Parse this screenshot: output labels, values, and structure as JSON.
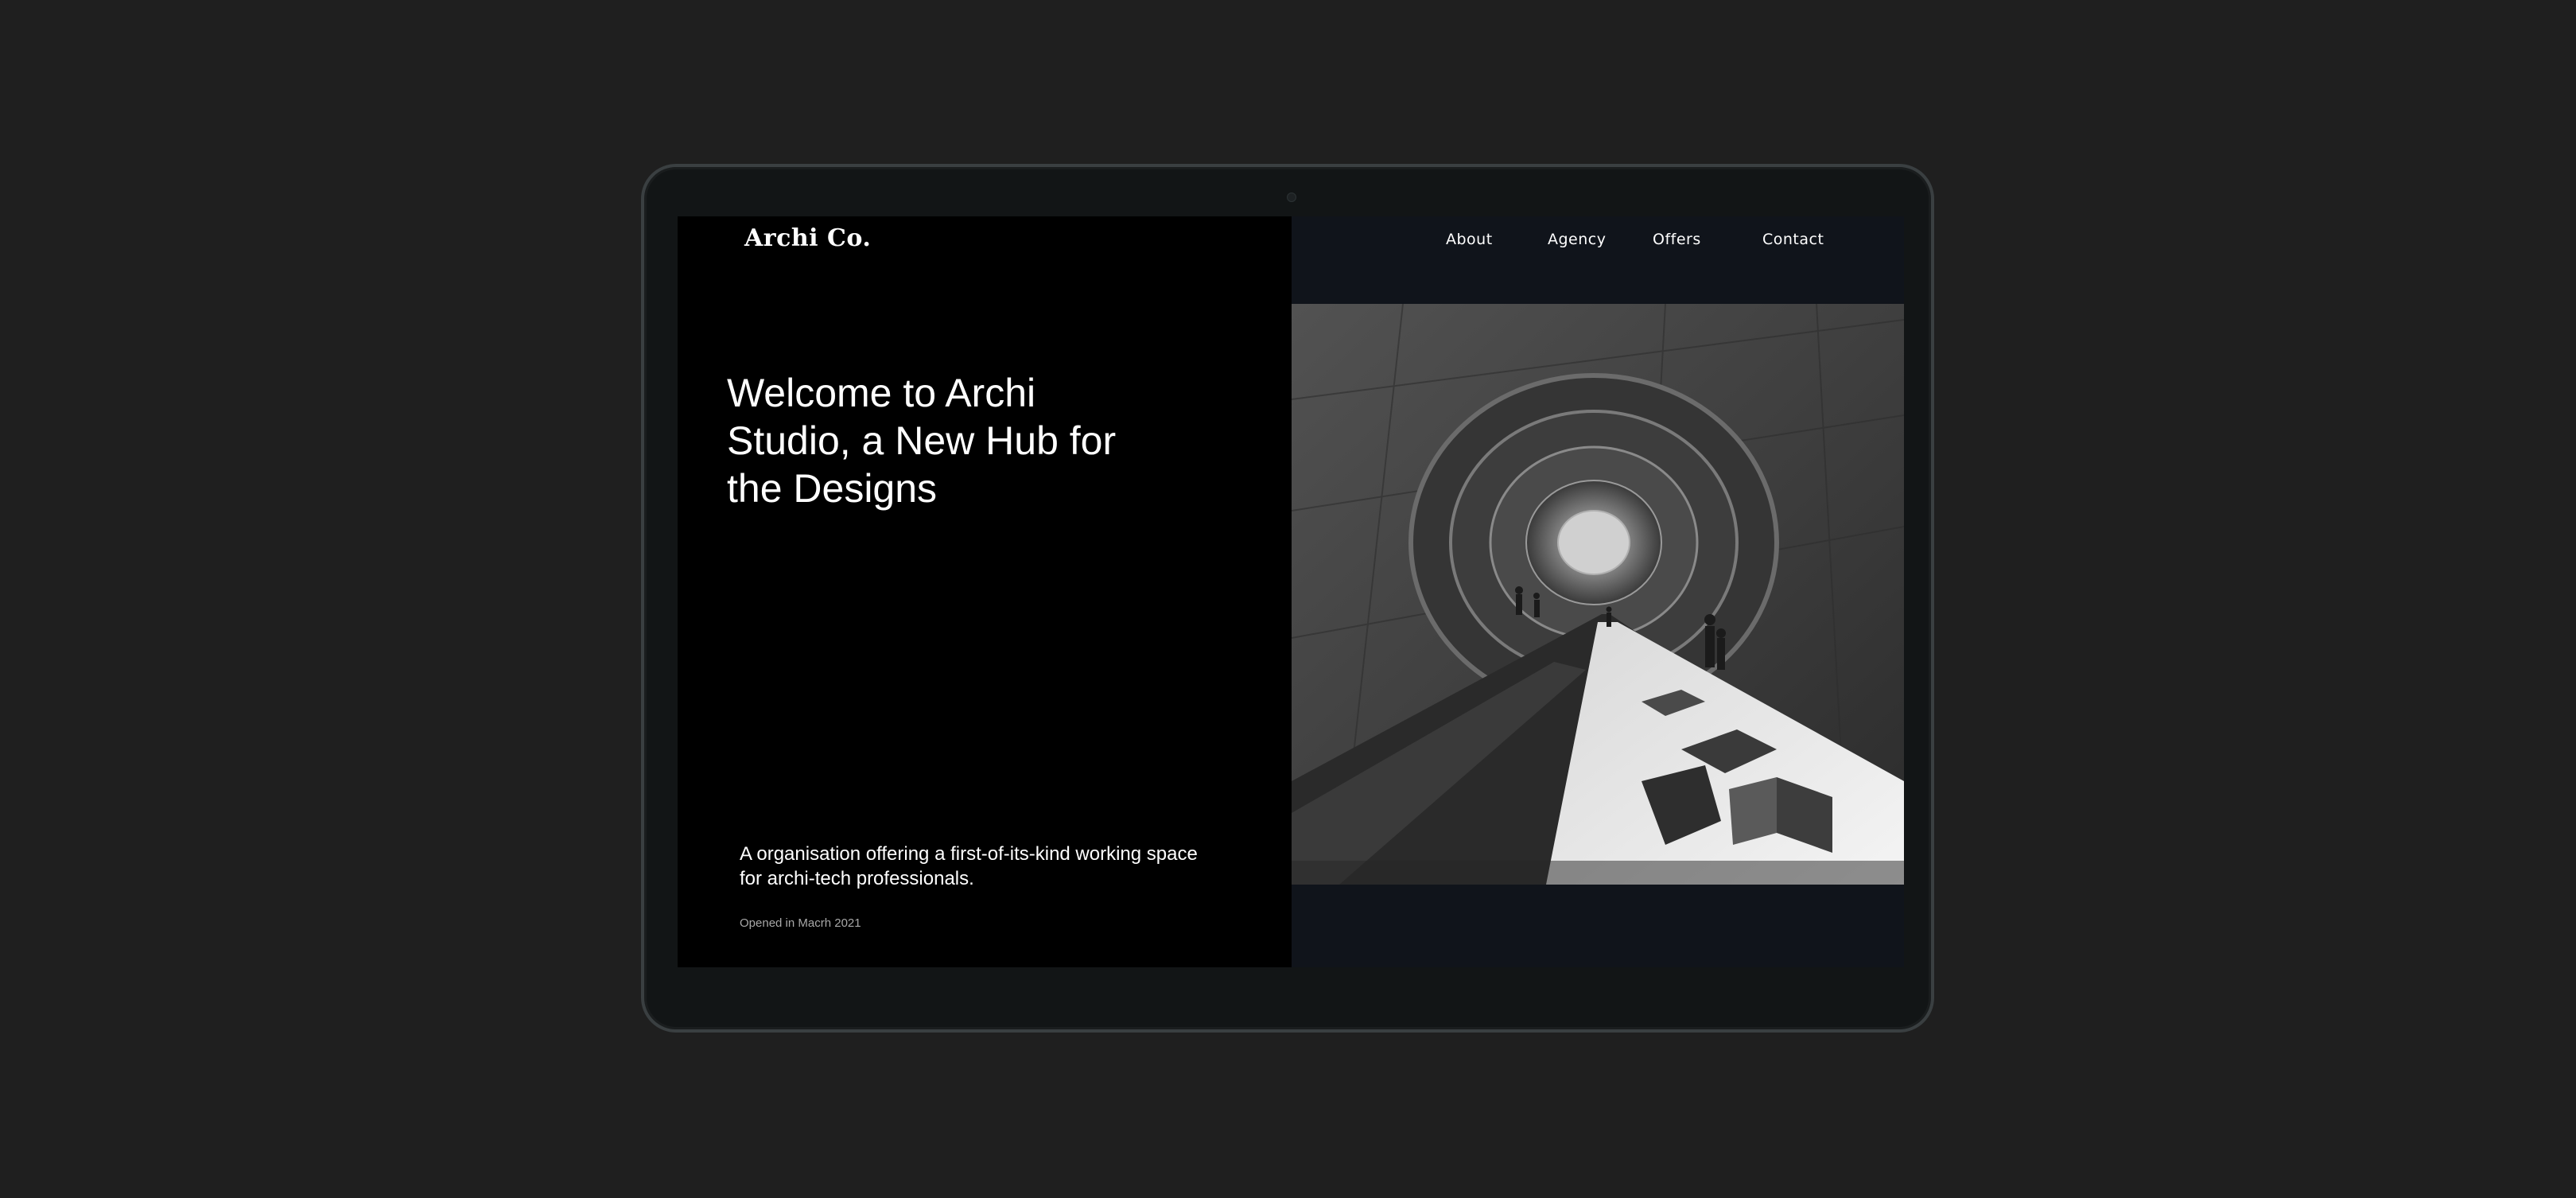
{
  "brand": {
    "logo_text": "Archi Co."
  },
  "nav": {
    "items": [
      {
        "label": "About"
      },
      {
        "label": "Agency"
      },
      {
        "label": "Offers"
      },
      {
        "label": "Contact"
      }
    ]
  },
  "hero": {
    "headline": "Welcome to Archi Studio, a New Hub for the Designs",
    "tagline": "A organisation offering a first-of-its-kind working space for archi-tech professionals.",
    "opened": "Opened in Macrh 2021"
  },
  "colors": {
    "page_background": "#1f1f1f",
    "device_frame": "#3a3f41",
    "left_panel": "#000000",
    "right_panel": "#10141b",
    "text": "#ffffff"
  }
}
